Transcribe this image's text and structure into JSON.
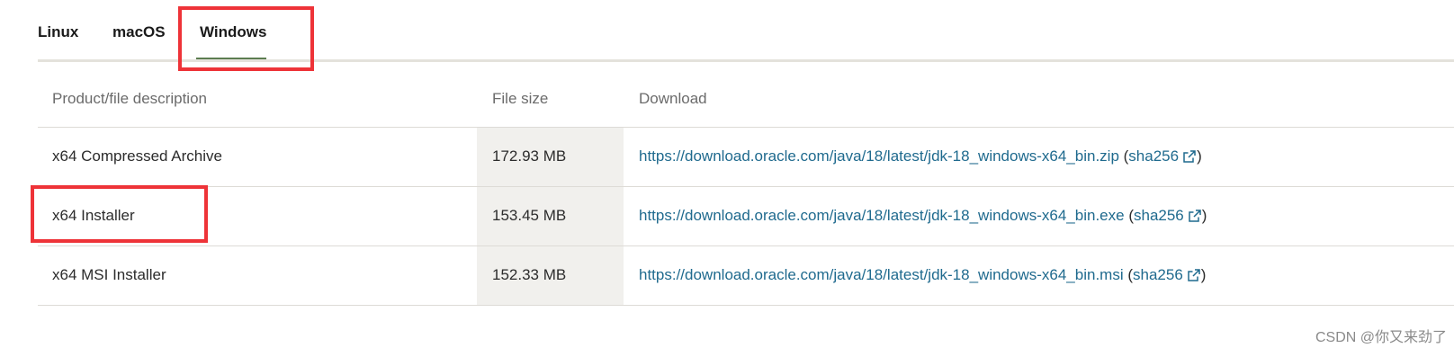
{
  "tabs": [
    {
      "label": "Linux"
    },
    {
      "label": "macOS"
    },
    {
      "label": "Windows",
      "selected": true
    }
  ],
  "accent_color": "#5c7d50",
  "highlight_color": "#ee3338",
  "table": {
    "headers": {
      "description": "Product/file description",
      "size": "File size",
      "download": "Download"
    },
    "rows": [
      {
        "description": "x64 Compressed Archive",
        "size": "172.93 MB",
        "url": "https://download.oracle.com/java/18/latest/jdk-18_windows-x64_bin.zip",
        "checksum": "sha256"
      },
      {
        "description": "x64 Installer",
        "size": "153.45 MB",
        "url": "https://download.oracle.com/java/18/latest/jdk-18_windows-x64_bin.exe",
        "checksum": "sha256"
      },
      {
        "description": "x64 MSI Installer",
        "size": "152.33 MB",
        "url": "https://download.oracle.com/java/18/latest/jdk-18_windows-x64_bin.msi",
        "checksum": "sha256"
      }
    ]
  },
  "watermark": "CSDN @你又来劲了",
  "icons": {
    "external_link": "external-link-icon"
  }
}
